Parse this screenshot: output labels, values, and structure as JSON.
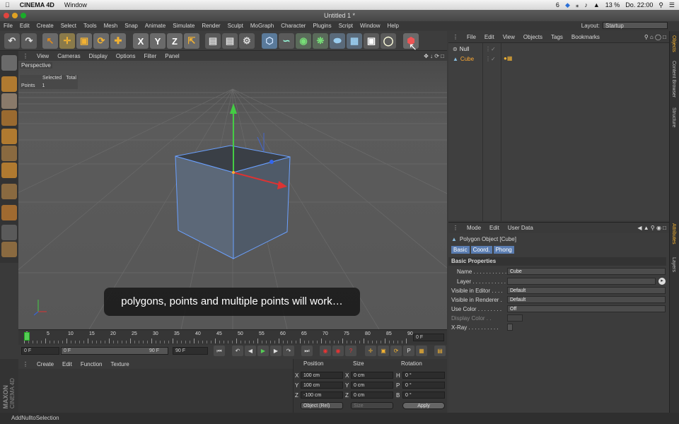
{
  "mac": {
    "app": "CINEMA 4D",
    "menu": [
      "Window"
    ],
    "status": {
      "ai": "6",
      "wifi_battery": "13 %",
      "clock": "Do. 22:00"
    }
  },
  "window": {
    "title": "Untitled 1 *"
  },
  "app_menu": [
    "File",
    "Edit",
    "Create",
    "Select",
    "Tools",
    "Mesh",
    "Snap",
    "Animate",
    "Simulate",
    "Render",
    "Sculpt",
    "MoGraph",
    "Character",
    "Plugins",
    "Script",
    "Window",
    "Help"
  ],
  "layout": {
    "label": "Layout:",
    "value": "Startup"
  },
  "toolbar_axes": [
    "X",
    "Y",
    "Z"
  ],
  "viewport": {
    "menu": [
      "View",
      "Cameras",
      "Display",
      "Options",
      "Filter",
      "Panel"
    ],
    "name": "Perspective",
    "stats": {
      "col1": "Selected",
      "col2": "Total",
      "row_label": "Points",
      "row_val": "1"
    }
  },
  "caption": "polygons, points and multiple points will work…",
  "timeline": {
    "ticks": [
      "0",
      "5",
      "10",
      "15",
      "20",
      "25",
      "30",
      "35",
      "40",
      "45",
      "50",
      "55",
      "60",
      "65",
      "70",
      "75",
      "80",
      "85",
      "90"
    ],
    "current": "0 F"
  },
  "transport": {
    "start": "0 F",
    "range_start": "0 F",
    "range_end": "90 F",
    "end": "90 F"
  },
  "material_menu": [
    "Create",
    "Edit",
    "Function",
    "Texture"
  ],
  "brand": {
    "maxon": "MAXON",
    "product": "CINEMA 4D"
  },
  "coords": {
    "headers": [
      "Position",
      "Size",
      "Rotation"
    ],
    "rows": [
      {
        "axis": "X",
        "pos": "100 cm",
        "saxis": "X",
        "size": "0 cm",
        "raxis": "H",
        "rot": "0 °"
      },
      {
        "axis": "Y",
        "pos": "100 cm",
        "saxis": "Y",
        "size": "0 cm",
        "raxis": "P",
        "rot": "0 °"
      },
      {
        "axis": "Z",
        "pos": "-100 cm",
        "saxis": "Z",
        "size": "0 cm",
        "raxis": "B",
        "rot": "0 °"
      }
    ],
    "mode": "Object (Rel)",
    "size_mode": "Size",
    "apply": "Apply"
  },
  "status_text": "AddNulltoSelection",
  "objects": {
    "menu": [
      "File",
      "Edit",
      "View",
      "Objects",
      "Tags",
      "Bookmarks"
    ],
    "items": [
      {
        "name": "Null",
        "color": "#e6e6e6"
      },
      {
        "name": "Cube",
        "color": "#ffaa33"
      }
    ]
  },
  "attributes": {
    "menu": [
      "Mode",
      "Edit",
      "User Data"
    ],
    "object_title": "Polygon Object [Cube]",
    "tabs": [
      "Basic",
      "Coord.",
      "Phong"
    ],
    "section": "Basic Properties",
    "fields": [
      {
        "label": "Name . . . . . . . . . . . . .",
        "value": "Cube"
      },
      {
        "label": "Layer . . . . . . . . . . . .",
        "value": ""
      },
      {
        "label": "Visible in Editor . . . .",
        "value": "Default"
      },
      {
        "label": "Visible in Renderer .",
        "value": "Default"
      },
      {
        "label": "Use Color . . . . . . . .",
        "value": "Off"
      },
      {
        "label": "Display Color . .",
        "value": ""
      },
      {
        "label": "X-Ray . . . . . . . . . .",
        "value": ""
      }
    ]
  },
  "side_tabs": [
    "Objects",
    "Content Browser",
    "Structure",
    "Attributes",
    "Layers"
  ]
}
